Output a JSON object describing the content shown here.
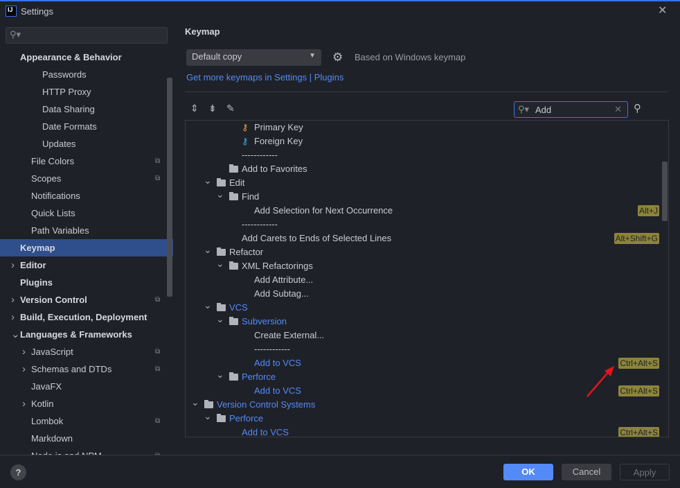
{
  "window": {
    "title": "Settings",
    "logo": "IJ"
  },
  "sidebar": {
    "search_placeholder": "",
    "items": [
      {
        "label": "Appearance & Behavior",
        "level": 0,
        "bold": true,
        "arrow": false
      },
      {
        "label": "Passwords",
        "level": 2
      },
      {
        "label": "HTTP Proxy",
        "level": 2
      },
      {
        "label": "Data Sharing",
        "level": 2
      },
      {
        "label": "Date Formats",
        "level": 2
      },
      {
        "label": "Updates",
        "level": 2
      },
      {
        "label": "File Colors",
        "level": 1,
        "proj": true
      },
      {
        "label": "Scopes",
        "level": 1,
        "proj": true
      },
      {
        "label": "Notifications",
        "level": 1
      },
      {
        "label": "Quick Lists",
        "level": 1
      },
      {
        "label": "Path Variables",
        "level": 1
      },
      {
        "label": "Keymap",
        "level": 0,
        "bold": true,
        "selected": true
      },
      {
        "label": "Editor",
        "level": 0,
        "bold": true,
        "arrow": "right"
      },
      {
        "label": "Plugins",
        "level": 0,
        "bold": true
      },
      {
        "label": "Version Control",
        "level": 0,
        "bold": true,
        "arrow": "right",
        "proj": true
      },
      {
        "label": "Build, Execution, Deployment",
        "level": 0,
        "bold": true,
        "arrow": "right"
      },
      {
        "label": "Languages & Frameworks",
        "level": 0,
        "bold": true,
        "arrow": "down"
      },
      {
        "label": "JavaScript",
        "level": 1,
        "arrow": "right",
        "proj": true
      },
      {
        "label": "Schemas and DTDs",
        "level": 1,
        "arrow": "right",
        "proj": true
      },
      {
        "label": "JavaFX",
        "level": 1
      },
      {
        "label": "Kotlin",
        "level": 1,
        "arrow": "right"
      },
      {
        "label": "Lombok",
        "level": 1,
        "proj": true
      },
      {
        "label": "Markdown",
        "level": 1
      },
      {
        "label": "Node.js and NPM",
        "level": 1,
        "proj": true
      }
    ]
  },
  "main": {
    "title": "Keymap",
    "keymap_value": "Default copy",
    "based_on": "Based on Windows keymap",
    "link": "Get more keymaps in Settings | Plugins",
    "search_value": "Add"
  },
  "tree": [
    {
      "label": "Primary Key",
      "level": 3,
      "icon": "key",
      "color": "#e0a93a"
    },
    {
      "label": "Foreign Key",
      "level": 3,
      "icon": "key",
      "color": "#3ab4e0"
    },
    {
      "label": "------------",
      "level": 2
    },
    {
      "label": "Add to Favorites",
      "level": 2,
      "folder": true
    },
    {
      "label": "Edit",
      "level": 1,
      "folder": true,
      "arrow": true
    },
    {
      "label": "Find",
      "level": 2,
      "folder": true,
      "arrow": true
    },
    {
      "label": "Add Selection for Next Occurrence",
      "level": 3,
      "shortcut": "Alt+J"
    },
    {
      "label": "------------",
      "level": 2
    },
    {
      "label": "Add Carets to Ends of Selected Lines",
      "level": 2,
      "shortcut": "Alt+Shift+G"
    },
    {
      "label": "Refactor",
      "level": 1,
      "folder": true,
      "arrow": true
    },
    {
      "label": "XML Refactorings",
      "level": 2,
      "folder": true,
      "arrow": true
    },
    {
      "label": "Add Attribute...",
      "level": 3
    },
    {
      "label": "Add Subtag...",
      "level": 3
    },
    {
      "label": "VCS",
      "level": 1,
      "folder": true,
      "arrow": true,
      "blue": true
    },
    {
      "label": "Subversion",
      "level": 2,
      "folder": true,
      "arrow": true,
      "blue": true
    },
    {
      "label": "Create External...",
      "level": 3
    },
    {
      "label": "------------",
      "level": 3
    },
    {
      "label": "Add to VCS",
      "level": 3,
      "blue": true,
      "shortcut": "Ctrl+Alt+S"
    },
    {
      "label": "Perforce",
      "level": 2,
      "folder": true,
      "arrow": true,
      "blue": true
    },
    {
      "label": "Add to VCS",
      "level": 3,
      "blue": true,
      "shortcut": "Ctrl+Alt+S"
    },
    {
      "label": "Version Control Systems",
      "level": 0,
      "folder": true,
      "arrow": true,
      "blue": true
    },
    {
      "label": "Perforce",
      "level": 1,
      "folder": true,
      "arrow": true,
      "blue": true
    },
    {
      "label": "Add to VCS",
      "level": 2,
      "blue": true,
      "shortcut": "Ctrl+Alt+S"
    }
  ],
  "footer": {
    "help": "?",
    "ok": "OK",
    "cancel": "Cancel",
    "apply": "Apply"
  }
}
